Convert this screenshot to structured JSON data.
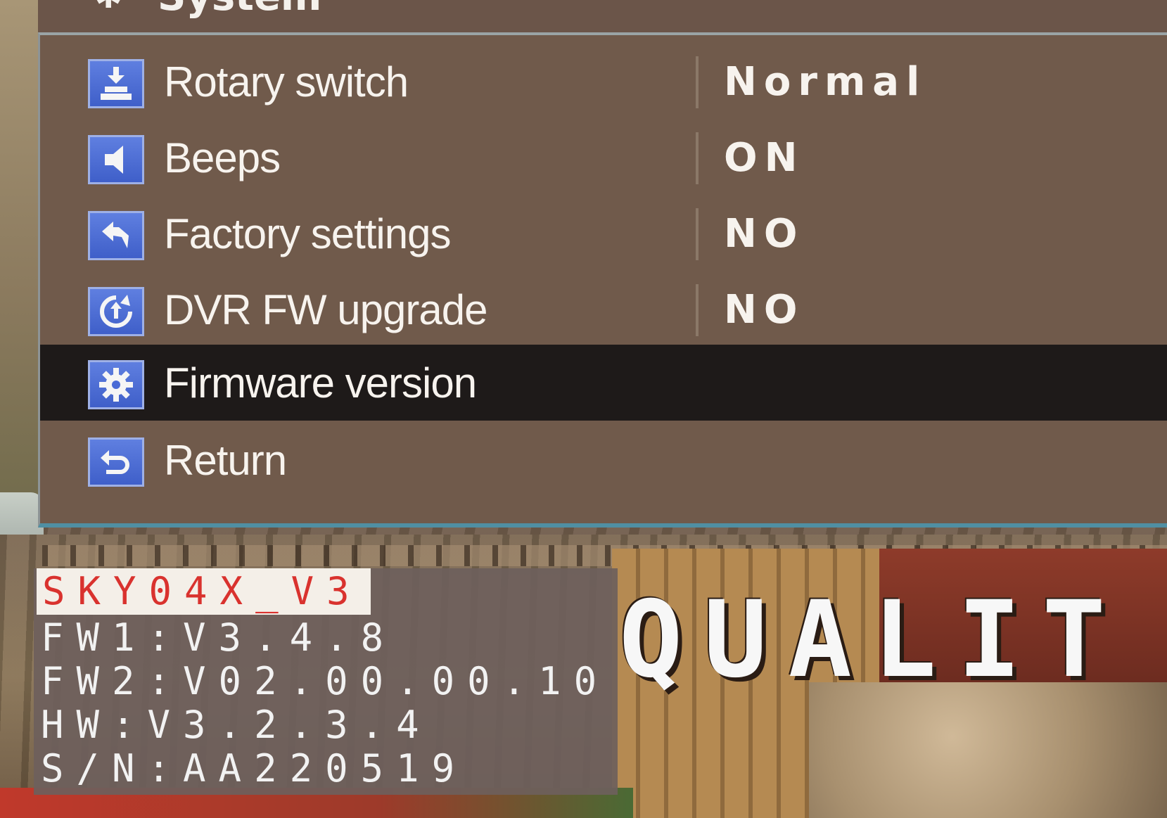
{
  "menu": {
    "header_title": "System",
    "items": [
      {
        "label": "Rotary switch",
        "value": "Normal",
        "icon": "download-icon"
      },
      {
        "label": "Beeps",
        "value": "ON",
        "icon": "speaker-icon"
      },
      {
        "label": "Factory settings",
        "value": "NO",
        "icon": "reply-arrow-icon"
      },
      {
        "label": "DVR FW upgrade",
        "value": "NO",
        "icon": "firmware-upgrade-icon"
      },
      {
        "label": "Firmware version",
        "value": "",
        "icon": "gear-icon",
        "selected": true
      },
      {
        "label": "Return",
        "value": "",
        "icon": "return-icon"
      }
    ]
  },
  "firmware_info": {
    "model": "SKY04X_V3",
    "fw1": "FW1:V3.4.8",
    "fw2": "FW2:V02.00.00.10",
    "hw": "HW:V3.2.3.4",
    "sn": "S/N:AA220519"
  },
  "overlay_text": "QUALIT",
  "colors": {
    "menu_bg": "#705a4b",
    "selected_row_bg": "#1e1a19",
    "icon_bg": "#4a6bd6",
    "model_text": "#d9322e",
    "panel_bottom_border": "#4f8fa3"
  }
}
